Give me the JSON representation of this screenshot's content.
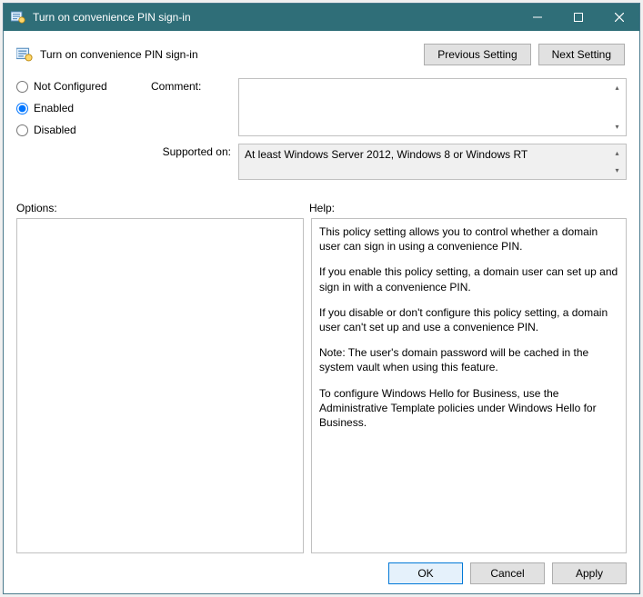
{
  "window": {
    "title": "Turn on convenience PIN sign-in"
  },
  "header": {
    "policy_name": "Turn on convenience PIN sign-in",
    "prev_label": "Previous Setting",
    "next_label": "Next Setting"
  },
  "state": {
    "not_configured_label": "Not Configured",
    "enabled_label": "Enabled",
    "disabled_label": "Disabled",
    "selected": "enabled"
  },
  "form": {
    "comment_label": "Comment:",
    "comment_value": "",
    "supported_label": "Supported on:",
    "supported_value": "At least Windows Server 2012, Windows 8 or Windows RT"
  },
  "panes": {
    "options_label": "Options:",
    "help_label": "Help:",
    "help_paragraphs": [
      "This policy setting allows you to control whether a domain user can sign in using a convenience PIN.",
      "If you enable this policy setting, a domain user can set up and sign in with a convenience PIN.",
      "If you disable or don't configure this policy setting, a domain user can't set up and use a convenience PIN.",
      "Note: The user's domain password will be cached in the system vault when using this feature.",
      "To configure Windows Hello for Business, use the Administrative Template policies under Windows Hello for Business."
    ]
  },
  "footer": {
    "ok_label": "OK",
    "cancel_label": "Cancel",
    "apply_label": "Apply"
  }
}
